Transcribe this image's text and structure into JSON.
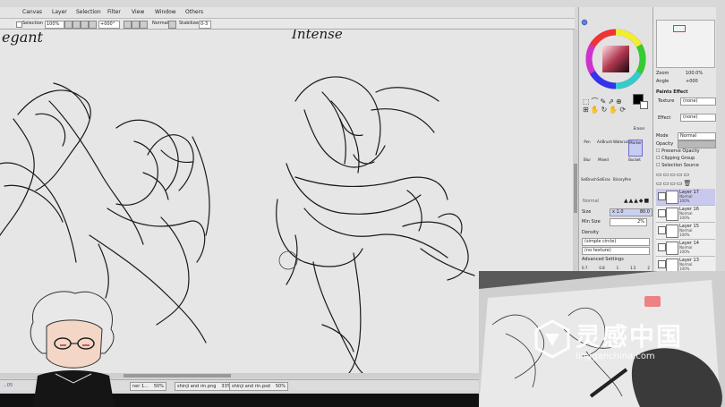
{
  "menu": [
    "Canvas",
    "Layer",
    "Selection",
    "Filter",
    "View",
    "Window",
    "Others"
  ],
  "toolbar": {
    "selection_label": "Selection",
    "zoom": "100%",
    "rotation": "+000°",
    "blend_mode": "Normal",
    "stabilizer_label": "Stabilizer",
    "stabilizer_value": "0-3"
  },
  "canvas_text": {
    "left": "egant",
    "center": "Intense"
  },
  "doc_tabs": [
    {
      "name": "ner 1...",
      "zoom": "50%"
    },
    {
      "name": "shinji and rin.png",
      "zoom": "33%"
    },
    {
      "name": "shinji and rin.psd",
      "zoom": "50%"
    }
  ],
  "status_left": "...05",
  "navigator": {
    "zoom_label": "Zoom",
    "zoom_value": "100.0%",
    "angle_label": "Angle",
    "angle_value": "+000"
  },
  "paint_effect": {
    "title": "Paints Effect",
    "texture_label": "Texture",
    "texture_value": "(none)",
    "effect_label": "Effect",
    "effect_value": "(none)"
  },
  "layer_props": {
    "mode_label": "Mode",
    "mode_value": "Normal",
    "opacity_label": "Opacity",
    "preserve_opacity": "Preserve Opacity",
    "clipping_group": "Clipping Group",
    "selection_source": "Selection Source"
  },
  "tools": [
    {
      "label": "Eraser"
    },
    {
      "label": "Pen"
    },
    {
      "label": "AirBrush"
    },
    {
      "label": "Watercol"
    },
    {
      "label": "Marker",
      "selected": true
    },
    {
      "label": "Blur"
    },
    {
      "label": "Mixed"
    },
    {
      "label": "Bucket"
    },
    {
      "label": "SelBrush"
    },
    {
      "label": "SelEras"
    },
    {
      "label": "BinaryPen"
    }
  ],
  "brush": {
    "normal_label": "Normal",
    "size_label": "Size",
    "size_multiplier": "x 1.0",
    "size_value": "80.0",
    "min_size_label": "Min Size",
    "min_size_value": "2%",
    "density_label": "Density",
    "shape_value": "(simple circle)",
    "texture_value": "(no texture)",
    "advanced_label": "Advanced Settings",
    "size_presets": [
      "0.7",
      "0.8",
      "1",
      "1.5",
      "2"
    ]
  },
  "layers": [
    {
      "name": "Layer 17",
      "mode": "Normal",
      "opacity": "100%",
      "selected": true
    },
    {
      "name": "Layer 16",
      "mode": "Normal",
      "opacity": "100%"
    },
    {
      "name": "Layer 15",
      "mode": "Normal",
      "opacity": "100%"
    },
    {
      "name": "Layer 14",
      "mode": "Normal",
      "opacity": "100%"
    },
    {
      "name": "Layer 13",
      "mode": "Normal",
      "opacity": "100%"
    }
  ],
  "watermark": {
    "cn": "灵感中国",
    "url": "lingganchina.com"
  },
  "colors": {
    "app_bg": "#d8d8d8",
    "canvas_bg": "#e6e6e6",
    "selected_layer": "#c9c9ee",
    "frame": "#111111"
  }
}
